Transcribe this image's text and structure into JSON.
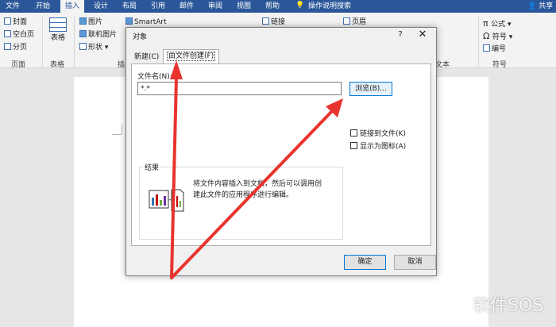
{
  "ribbon_tabs": [
    {
      "label": "文件"
    },
    {
      "label": "开始"
    },
    {
      "label": "插入"
    },
    {
      "label": "设计"
    },
    {
      "label": "布局"
    },
    {
      "label": "引用"
    },
    {
      "label": "邮件"
    },
    {
      "label": "审阅"
    },
    {
      "label": "视图"
    },
    {
      "label": "帮助"
    }
  ],
  "tell_me": "操作说明搜索",
  "share": "共享",
  "ribbon": {
    "pages": {
      "cover": "封面",
      "blank": "空白页",
      "break": "分页",
      "label": "页面"
    },
    "tables": {
      "table": "表格",
      "label": "表格"
    },
    "illustrations": {
      "picture": "图片",
      "online_picture": "联机图片",
      "shapes": "形状",
      "smartart": "SmartArt",
      "label": "插"
    },
    "links": {
      "link": "链接"
    },
    "header": {
      "header": "页眉"
    },
    "text": {
      "label": "文本"
    },
    "symbols": {
      "equation": "公式",
      "symbol": "符号",
      "numbering": "编号",
      "label": "符号"
    }
  },
  "dialog": {
    "title": "对象",
    "help": "?",
    "close": "✕",
    "tabs": {
      "new": "新建(C)",
      "from_file": "由文件创建(F)"
    },
    "filename_label": "文件名(N):",
    "filename_value": "*.*",
    "browse": "浏览(B)...",
    "link_to_file": "链接到文件(K)",
    "display_as_icon": "显示为图标(A)",
    "result_label": "结果",
    "result_text": "将文件内容插入到文档，然后可以调用创建此文件的应用程序进行编辑。",
    "ok": "确定",
    "cancel": "取消"
  },
  "watermark": "软件SOS",
  "colors": {
    "accent": "#2b579a",
    "arrow": "#e8342e"
  }
}
